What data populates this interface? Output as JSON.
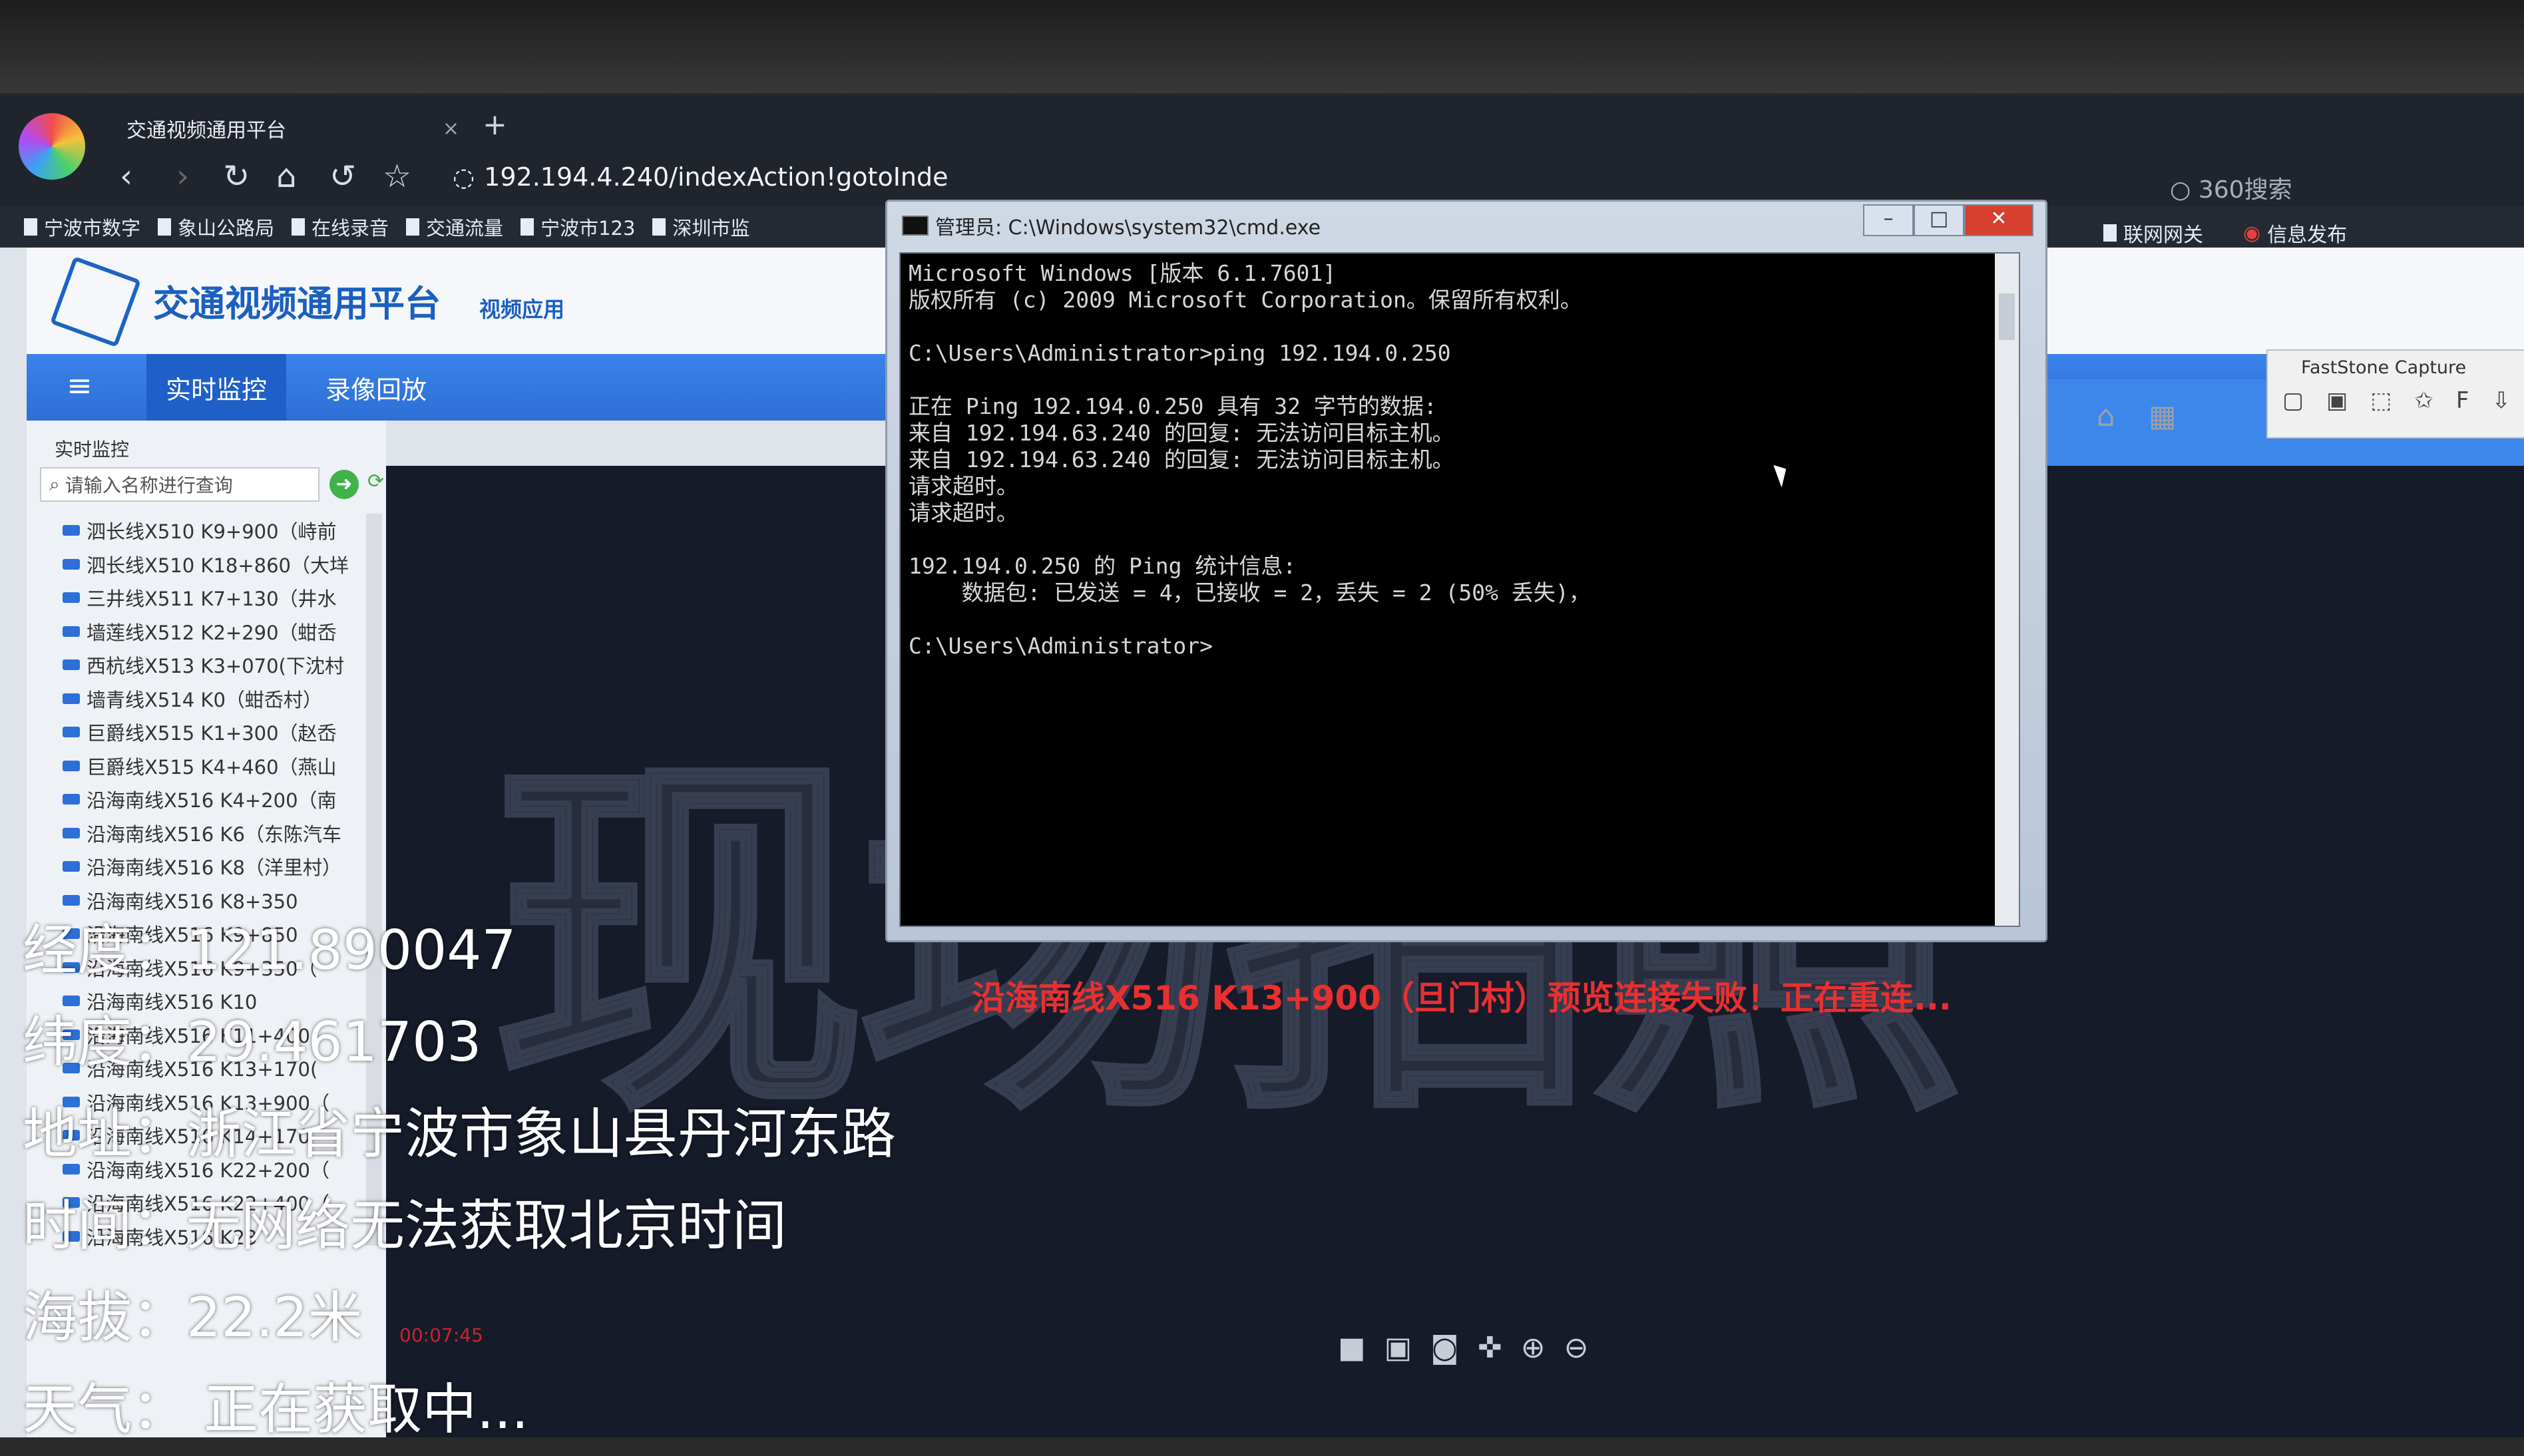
{
  "browser": {
    "tab_title": "交通视频通用平台",
    "tab_close": "×",
    "new_tab": "+",
    "url": "192.194.4.240/indexAction!gotoInde",
    "search_engine": "360搜索",
    "bookmarks": [
      "宁波市数字",
      "象山公路局",
      "在线录音",
      "交通流量",
      "宁波市123",
      "深圳市监"
    ],
    "bookmarks_right": [
      "联网网关",
      "信息发布"
    ]
  },
  "app": {
    "title": "交通视频通用平台",
    "subtitle": "视频应用",
    "menu_icon": "≡",
    "nav": [
      "实时监控",
      "录像回放"
    ],
    "sidebar_label": "实时监控",
    "search_placeholder": "请输入名称进行查询",
    "cameras": [
      "泗长线X510 K9+900（峙前",
      "泗长线X510 K18+860（大垟",
      "三井线X511 K7+130（井水",
      "墙莲线X512 K2+290（蚶岙",
      "西杭线X513 K3+070(下沈村",
      "墙青线X514 K0（蚶岙村）",
      "巨爵线X515 K1+300（赵岙",
      "巨爵线X515 K4+460（燕山",
      "沿海南线X516 K4+200（南",
      "沿海南线X516 K6（东陈汽车",
      "沿海南线X516 K8（洋里村）",
      "沿海南线X516 K8+350",
      "沿海南线X516 K9+850",
      "沿海南线X516 K9+350（",
      "沿海南线X516 K10",
      "沿海南线X516 K11+400",
      "沿海南线X516 K13+170(",
      "沿海南线X516 K13+900（",
      "沿海南线X516 K14+170",
      "沿海南线X516 K22+200（",
      "沿海南线X516 K22+400（",
      "沿海南线X516 K23"
    ]
  },
  "video": {
    "watermark": "现场拍照",
    "error": "沿海南线X516 K13+900（旦门村）预览连接失败！正在重连...",
    "timer": "00:07:45"
  },
  "faststone": {
    "title": "FastStone Capture"
  },
  "cmd": {
    "title": "管理员: C:\\Windows\\system32\\cmd.exe",
    "lines": [
      "Microsoft Windows [版本 6.1.7601]",
      "版权所有 (c) 2009 Microsoft Corporation。保留所有权利。",
      "",
      "C:\\Users\\Administrator>ping 192.194.0.250",
      "",
      "正在 Ping 192.194.0.250 具有 32 字节的数据:",
      "来自 192.194.63.240 的回复: 无法访问目标主机。",
      "来自 192.194.63.240 的回复: 无法访问目标主机。",
      "请求超时。",
      "请求超时。",
      "",
      "192.194.0.250 的 Ping 统计信息:",
      "    数据包: 已发送 = 4，已接收 = 2，丢失 = 2 (50% 丢失)，",
      "",
      "C:\\Users\\Administrator>"
    ]
  },
  "overlay": {
    "longitude": "经度：121.890047",
    "latitude": "纬度：29.461703",
    "address": "地址：浙江省宁波市象山县丹河东路",
    "time": "时间：无网络无法获取北京时间",
    "altitude": "海拔：22.2米",
    "weather": "天气：   正在获取中..."
  }
}
